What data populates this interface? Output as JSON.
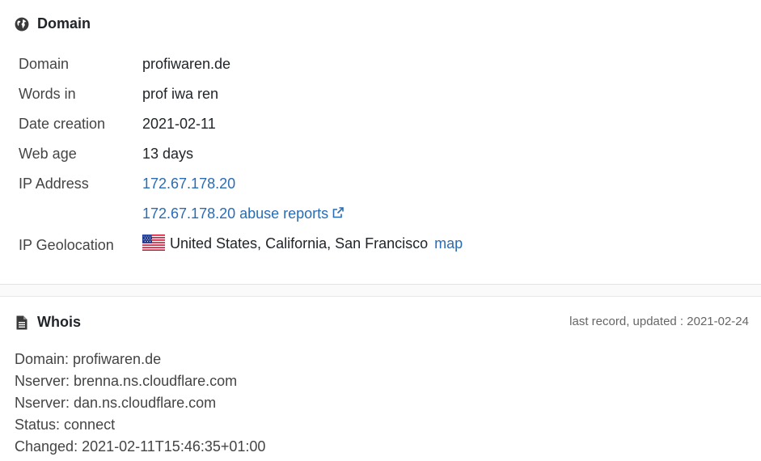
{
  "domain_section": {
    "title": "Domain",
    "icon": "globe-icon",
    "rows": [
      {
        "label": "Domain",
        "value": "profiwaren.de"
      },
      {
        "label": "Words in",
        "value": "prof iwa ren"
      },
      {
        "label": "Date creation",
        "value": "2021-02-11"
      },
      {
        "label": "Web age",
        "value": "13 days"
      },
      {
        "label": "IP Address",
        "value": "172.67.178.20"
      },
      {
        "label": "",
        "value": "172.67.178.20 abuse reports"
      },
      {
        "label": "IP Geolocation",
        "value": "United States, California, San Francisco",
        "link": "map",
        "flag": "us-flag-icon"
      }
    ]
  },
  "whois_section": {
    "title": "Whois",
    "icon": "document-icon",
    "updated": "last record, updated : 2021-02-24",
    "lines": [
      "Domain: profiwaren.de",
      "Nserver: brenna.ns.cloudflare.com",
      "Nserver: dan.ns.cloudflare.com",
      "Status: connect",
      "Changed: 2021-02-11T15:46:35+01:00"
    ]
  },
  "colors": {
    "link": "#2a6cb3",
    "text": "#212529",
    "label": "#444444",
    "muted": "#666666"
  }
}
